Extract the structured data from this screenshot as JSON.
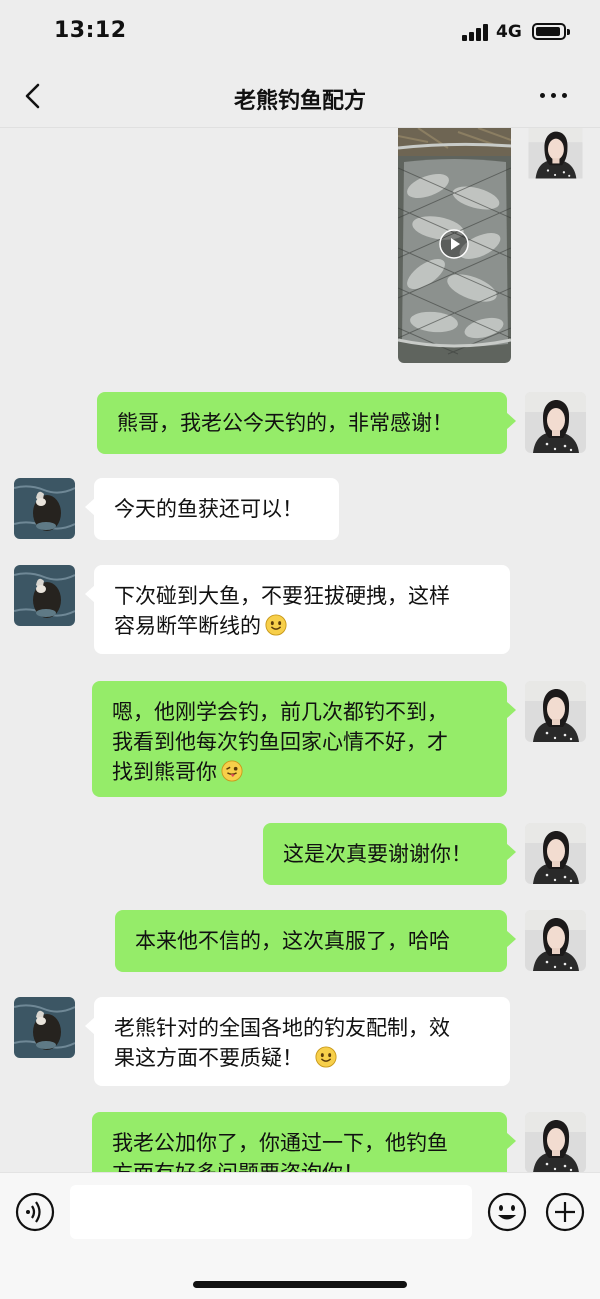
{
  "status": {
    "time": "13:12",
    "network": "4G"
  },
  "nav": {
    "title": "老熊钓鱼配方"
  },
  "messages": [
    {
      "text": "熊哥，我老公今天钓的，非常感谢！"
    },
    {
      "text": "今天的鱼获还可以！"
    },
    {
      "line1": "下次碰到大鱼，不要狂拔硬拽，这样",
      "line2": "容易断竿断线的"
    },
    {
      "line1": "嗯，他刚学会钓，前几次都钓不到，",
      "line2": "我看到他每次钓鱼回家心情不好，才",
      "line3": "找到熊哥你"
    },
    {
      "text": "这是次真要谢谢你！"
    },
    {
      "text": "本来他不信的，这次真服了，哈哈"
    },
    {
      "line1": "老熊针对的全国各地的钓友配制，效",
      "line2": "果这方面不要质疑！"
    },
    {
      "line1": "我老公加你了，你通过一下，他钓鱼",
      "line2": "方面有好多问题要咨询你！"
    }
  ],
  "input": {
    "placeholder": ""
  },
  "colors": {
    "my_bubble": "#95ec69",
    "other_bubble": "#ffffff",
    "background": "#ededed"
  },
  "icons": [
    "back-icon",
    "more-icon",
    "play-icon",
    "voice-icon",
    "emoji-icon",
    "plus-icon"
  ]
}
